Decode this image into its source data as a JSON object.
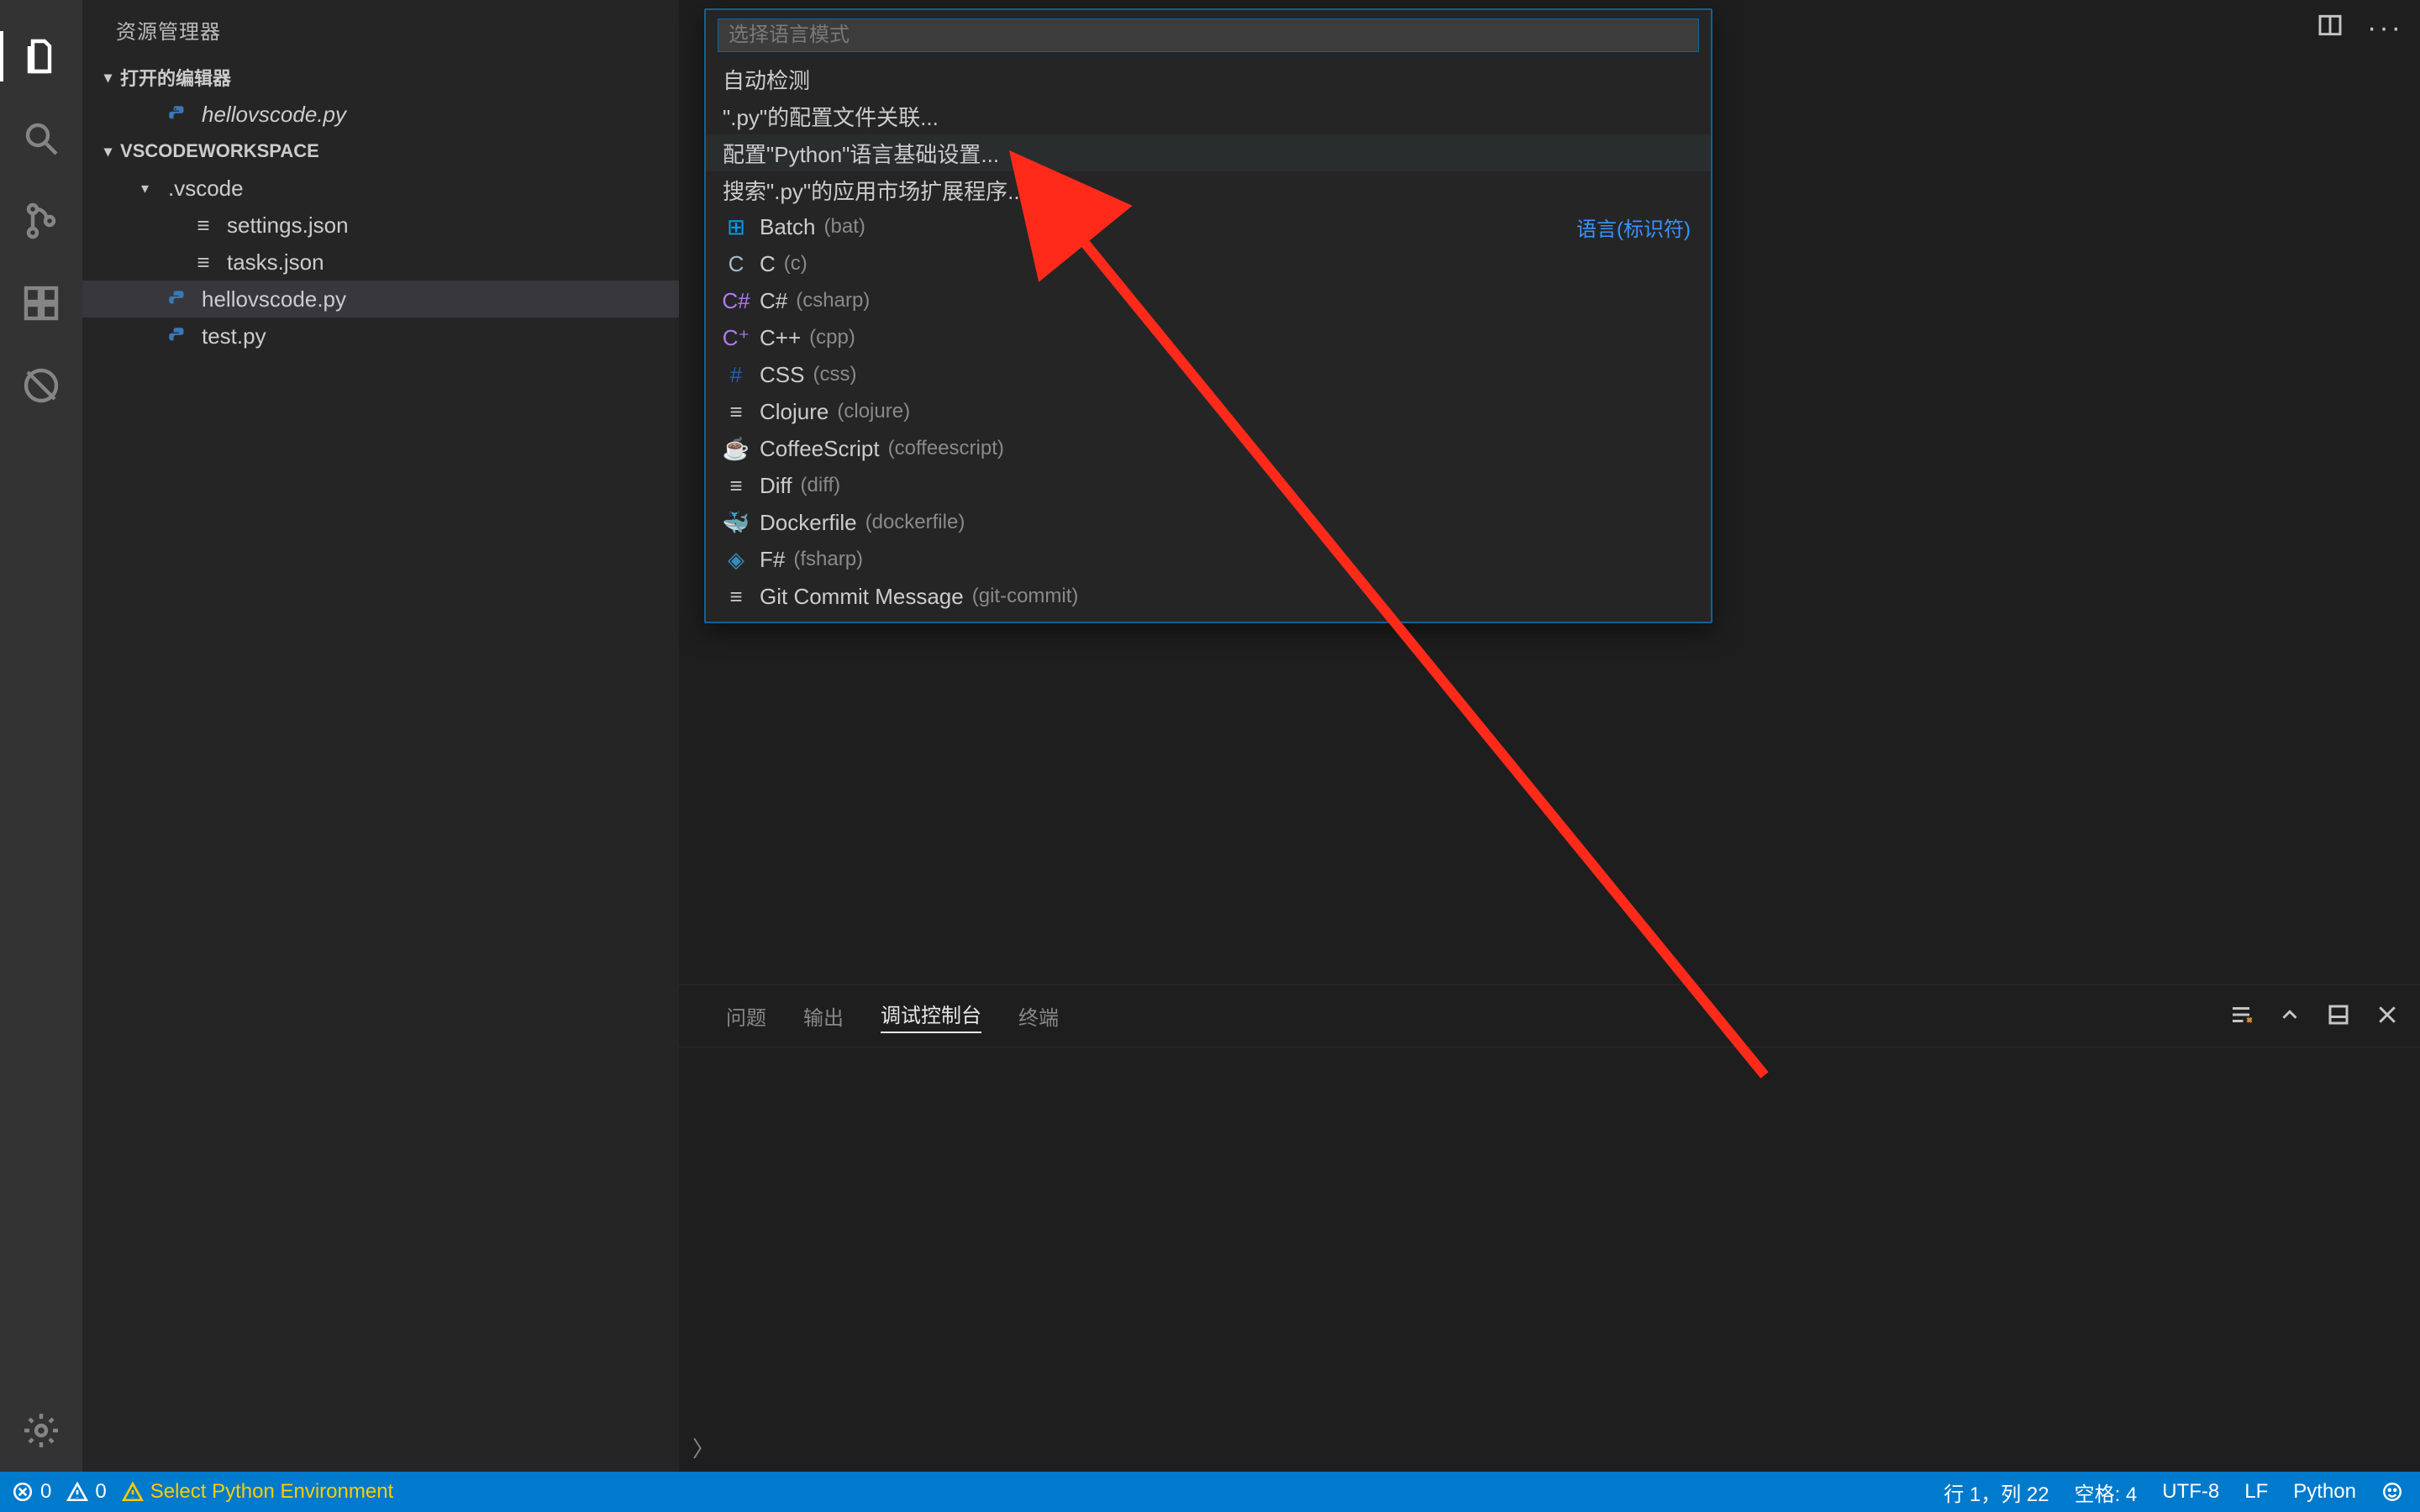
{
  "sidebar": {
    "title": "资源管理器",
    "open_editors_header": "打开的编辑器",
    "open_editor_file": "hellovscode.py",
    "workspace_header": "VSCODEWORKSPACE",
    "tree": {
      "folder_vscode": ".vscode",
      "settings_json": "settings.json",
      "tasks_json": "tasks.json",
      "hellovscode": "hellovscode.py",
      "test_py": "test.py"
    }
  },
  "quickpick": {
    "placeholder": "选择语言模式",
    "cmd_auto_detect": "自动检测",
    "cmd_configure_assoc": "\".py\"的配置文件关联...",
    "cmd_configure_python_basics": "配置\"Python\"语言基础设置...",
    "cmd_search_marketplace": "搜索\".py\"的应用市场扩展程序...",
    "right_hint": "语言(标识符)",
    "languages": [
      {
        "name": "Batch",
        "id": "bat",
        "icon": "lang-batch",
        "glyph": "⊞"
      },
      {
        "name": "C",
        "id": "c",
        "icon": "lang-c",
        "glyph": "C"
      },
      {
        "name": "C#",
        "id": "csharp",
        "icon": "lang-csharp",
        "glyph": "C#"
      },
      {
        "name": "C++",
        "id": "cpp",
        "icon": "lang-cpp",
        "glyph": "C⁺"
      },
      {
        "name": "CSS",
        "id": "css",
        "icon": "lang-css",
        "glyph": "#"
      },
      {
        "name": "Clojure",
        "id": "clojure",
        "icon": "lang-clojure",
        "glyph": "≡"
      },
      {
        "name": "CoffeeScript",
        "id": "coffeescript",
        "icon": "lang-coffeescript",
        "glyph": "☕"
      },
      {
        "name": "Diff",
        "id": "diff",
        "icon": "lang-diff",
        "glyph": "≡"
      },
      {
        "name": "Dockerfile",
        "id": "dockerfile",
        "icon": "lang-dockerfile",
        "glyph": "🐳"
      },
      {
        "name": "F#",
        "id": "fsharp",
        "icon": "lang-fsharp",
        "glyph": "◈"
      },
      {
        "name": "Git Commit Message",
        "id": "git-commit",
        "icon": "lang-gitcommit",
        "glyph": "≡"
      }
    ]
  },
  "panel": {
    "tab_problems": "问题",
    "tab_output": "输出",
    "tab_debug_console": "调试控制台",
    "tab_terminal": "终端"
  },
  "statusbar": {
    "errors": "0",
    "warnings": "0",
    "select_env": "Select Python Environment",
    "ln_col": "行 1，列 22",
    "spaces": "空格: 4",
    "encoding": "UTF-8",
    "eol": "LF",
    "language": "Python"
  }
}
